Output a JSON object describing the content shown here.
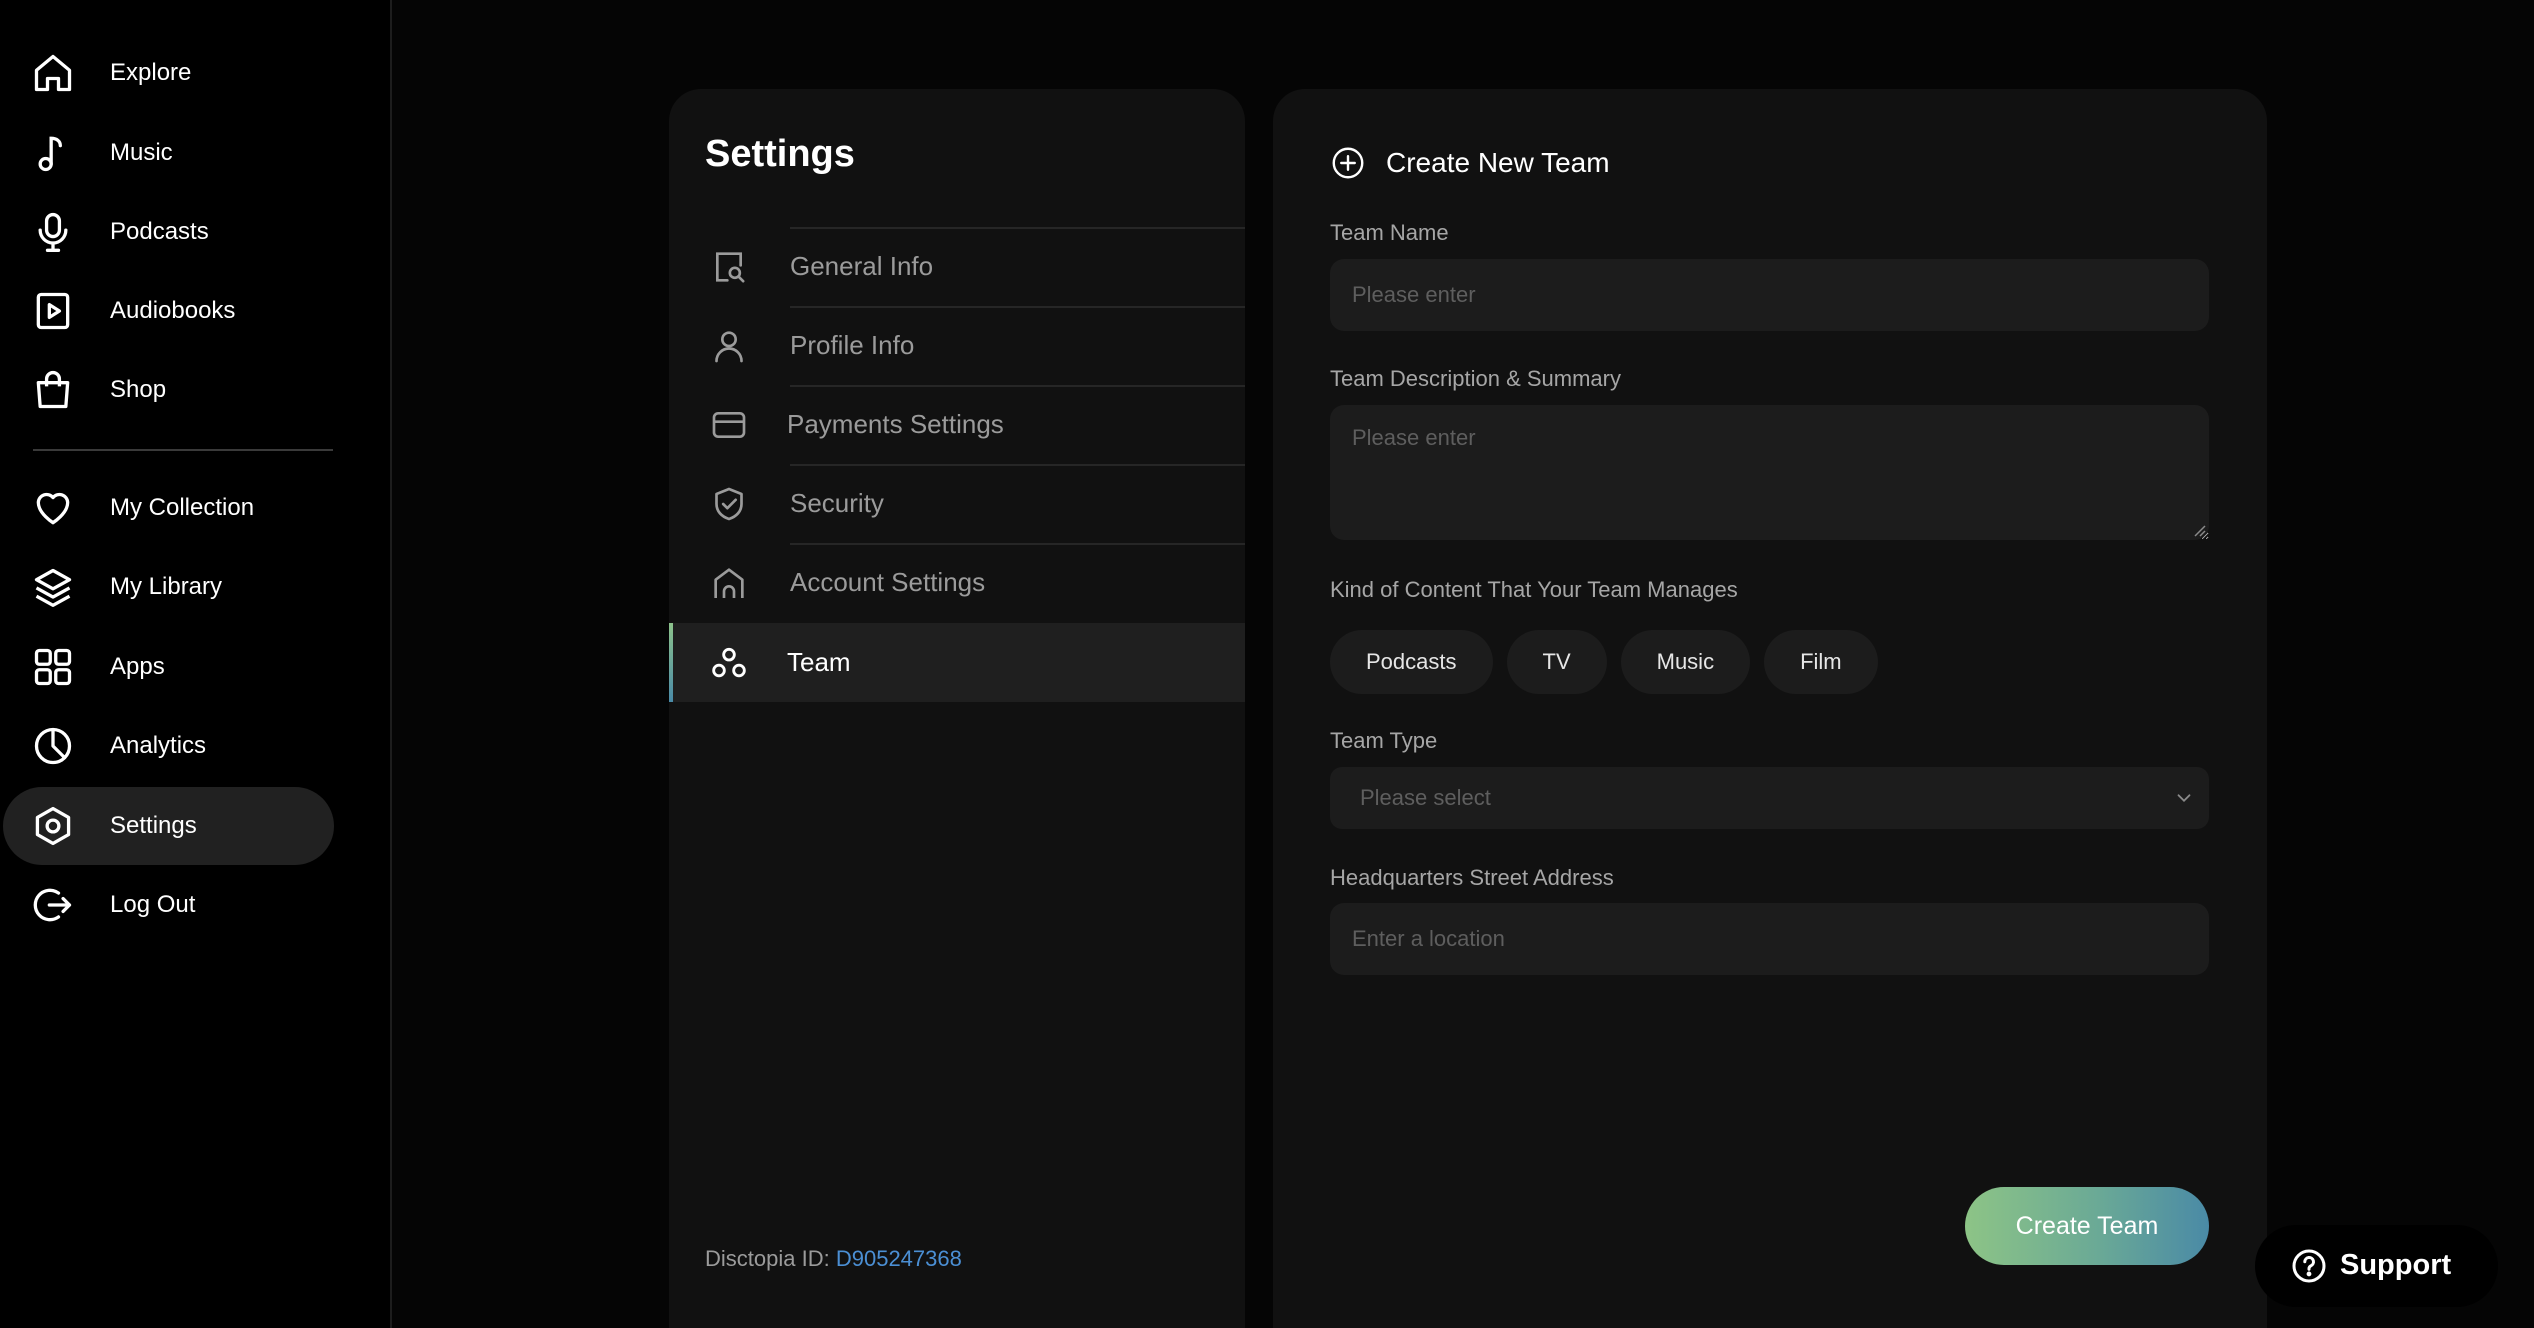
{
  "nav": {
    "items": [
      {
        "label": "Explore",
        "icon": "home-icon"
      },
      {
        "label": "Music",
        "icon": "music-note-icon"
      },
      {
        "label": "Podcasts",
        "icon": "microphone-icon"
      },
      {
        "label": "Audiobooks",
        "icon": "play-book-icon"
      },
      {
        "label": "Shop",
        "icon": "shopping-bag-icon"
      },
      {
        "label": "My Collection",
        "icon": "heart-icon"
      },
      {
        "label": "My Library",
        "icon": "layers-icon"
      },
      {
        "label": "Apps",
        "icon": "grid-icon"
      },
      {
        "label": "Analytics",
        "icon": "pie-chart-icon"
      },
      {
        "label": "Settings",
        "icon": "hexagon-gear-icon"
      },
      {
        "label": "Log Out",
        "icon": "logout-icon"
      }
    ],
    "active": "Settings"
  },
  "settings": {
    "title": "Settings",
    "items": [
      {
        "label": "General Info",
        "icon": "document-search-icon"
      },
      {
        "label": "Profile Info",
        "icon": "user-icon"
      },
      {
        "label": "Payments Settings",
        "icon": "card-icon"
      },
      {
        "label": "Security",
        "icon": "shield-check-icon"
      },
      {
        "label": "Account Settings",
        "icon": "home-outline-icon"
      },
      {
        "label": "Team",
        "icon": "team-icon"
      }
    ],
    "active": "Team",
    "id_label": "Disctopia ID:",
    "id_value": "D905247368"
  },
  "team_form": {
    "title": "Create New Team",
    "team_name": {
      "label": "Team Name",
      "placeholder": "Please enter"
    },
    "description": {
      "label": "Team Description & Summary",
      "placeholder": "Please enter"
    },
    "content_kind": {
      "label": "Kind of Content That Your Team Manages",
      "options": [
        "Podcasts",
        "TV",
        "Music",
        "Film"
      ]
    },
    "team_type": {
      "label": "Team Type",
      "placeholder": "Please select"
    },
    "address": {
      "label": "Headquarters Street Address",
      "placeholder": "Enter a location"
    },
    "submit_label": "Create Team"
  },
  "support": {
    "label": "Support"
  },
  "colors": {
    "background": "#050505",
    "panel": "#111111",
    "input": "#1c1c1c",
    "accent_start": "#8dc486",
    "accent_end": "#4a8aa6",
    "link": "#4b8fd4"
  }
}
